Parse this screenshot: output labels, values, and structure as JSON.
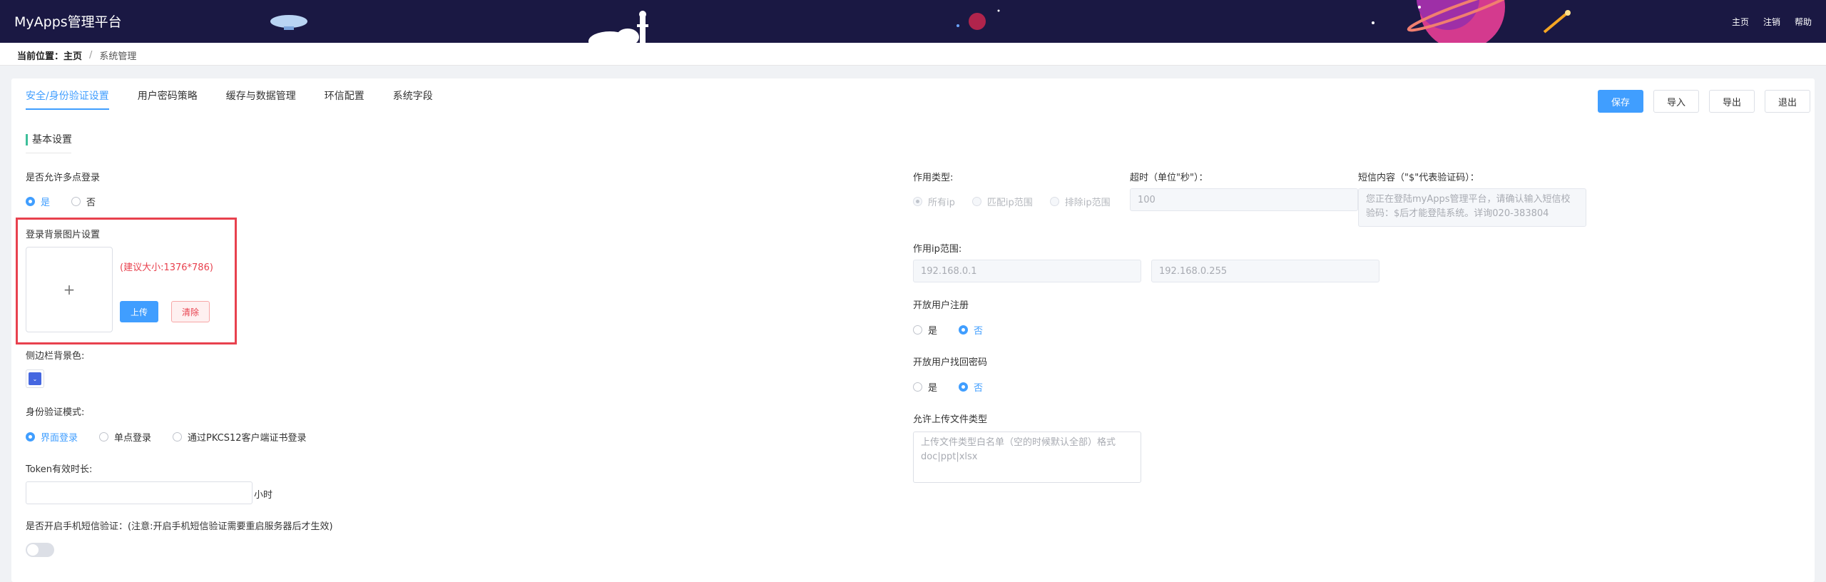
{
  "header": {
    "brand": "MyApps管理平台",
    "nav": [
      "主页",
      "注销",
      "帮助"
    ]
  },
  "breadcrumb": {
    "prefix": "当前位置：",
    "home": "主页",
    "separator": "/",
    "current": "系统管理"
  },
  "tabs": [
    "安全/身份验证设置",
    "用户密码策略",
    "缓存与数据管理",
    "环信配置",
    "系统字段"
  ],
  "toolbar": {
    "save": "保存",
    "import": "导入",
    "export": "导出",
    "exit": "退出"
  },
  "basic": {
    "title": "基本设置",
    "multi_login": {
      "label": "是否允许多点登录",
      "options": [
        "是",
        "否"
      ],
      "selected": "是"
    },
    "bg_image": {
      "label": "登录背景图片设置",
      "plus": "+",
      "hint": "(建议大小:1376*786)",
      "upload": "上传",
      "clear": "清除"
    },
    "sidebar_color": {
      "label": "侧边栏背景色:",
      "color": "#4567e0",
      "chevron": "⌄"
    },
    "auth_mode": {
      "label": "身份验证模式:",
      "options": [
        "界面登录",
        "单点登录",
        "通过PKCS12客户端证书登录"
      ],
      "selected": "界面登录"
    },
    "token": {
      "label": "Token有效时长:",
      "value": "",
      "unit": "小时"
    },
    "sms": {
      "label": "是否开启手机短信验证：(注意:开启手机短信验证需要重启服务器后才生效)",
      "enabled": false
    }
  },
  "right": {
    "scope_type": {
      "label": "作用类型:",
      "options": [
        "所有ip",
        "匹配ip范围",
        "排除ip范围"
      ],
      "selected": "所有ip"
    },
    "timeout": {
      "label": "超时（单位\"秒\"）：",
      "value": "100"
    },
    "sms_content": {
      "label": "短信内容（\"$\"代表验证码）：",
      "value": "您正在登陆myApps管理平台，请确认输入短信校验码：$后才能登陆系统。详询020-383804"
    },
    "ip_range": {
      "label": "作用ip范围:",
      "start": "192.168.0.1",
      "end": "192.168.0.255"
    },
    "open_register": {
      "label": "开放用户注册",
      "options": [
        "是",
        "否"
      ],
      "selected": "否"
    },
    "open_recover": {
      "label": "开放用户找回密码",
      "options": [
        "是",
        "否"
      ],
      "selected": "否"
    },
    "upload_types": {
      "label": "允许上传文件类型",
      "placeholder": "上传文件类型白名单（空的时候默认全部）格式doc|ppt|xlsx"
    }
  }
}
